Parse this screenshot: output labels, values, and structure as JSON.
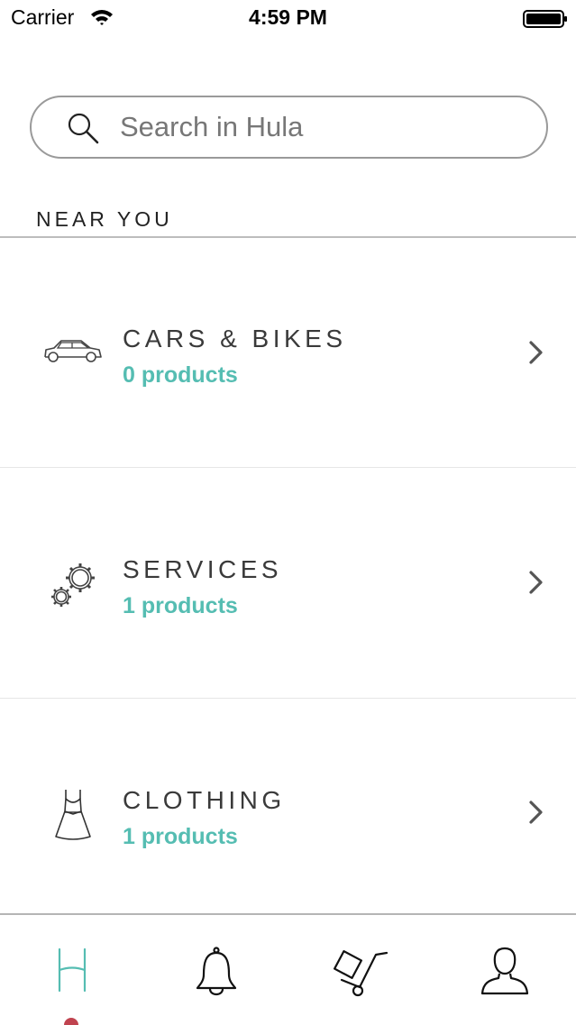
{
  "status_bar": {
    "carrier": "Carrier",
    "time": "4:59 PM"
  },
  "search": {
    "placeholder": "Search in Hula",
    "value": ""
  },
  "section": {
    "title": "NEAR YOU"
  },
  "categories": [
    {
      "title": "CARS & BIKES",
      "count": "0 products",
      "icon": "car-icon"
    },
    {
      "title": "SERVICES",
      "count": "1 products",
      "icon": "gears-icon"
    },
    {
      "title": "CLOTHING",
      "count": "1 products",
      "icon": "dress-icon"
    }
  ],
  "tab_bar": {
    "tabs": [
      {
        "icon": "hula-home-icon",
        "active": true
      },
      {
        "icon": "bell-icon",
        "active": false
      },
      {
        "icon": "hand-truck-icon",
        "active": false
      },
      {
        "icon": "user-icon",
        "active": false
      }
    ]
  },
  "colors": {
    "accent": "#55bdb2",
    "title_text": "#3a3a3a",
    "badge": "#c0434f"
  }
}
